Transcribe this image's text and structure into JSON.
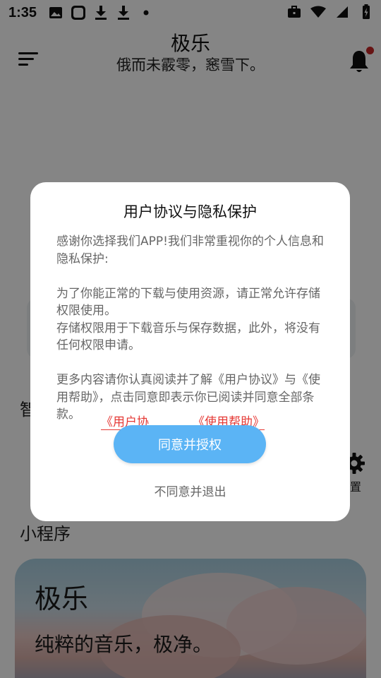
{
  "status_bar": {
    "time": "1:35",
    "left_icons": [
      "image-icon",
      "app-square-icon",
      "download-icon",
      "download-icon",
      "dot-icon"
    ],
    "right_icons": [
      "briefcase-icon",
      "wifi-icon",
      "signal-icon",
      "battery-charging-icon"
    ]
  },
  "header": {
    "title": "极乐",
    "subtitle": "俄而未霰零，窸雪下。"
  },
  "background": {
    "left_label": "智",
    "settings_label": "置",
    "section_title": "小程序",
    "banner": {
      "title": "极乐",
      "subtitle": "纯粹的音乐，极净。"
    }
  },
  "dialog": {
    "title": "用户协议与隐私保护",
    "para1": "感谢你选择我们APP!我们非常重视你的个人信息和隐私保护:",
    "para2": "为了你能正常的下载与使用资源，请正常允许存储权限使用。",
    "para3": "存储权限用于下载音乐与保存数据，此外，将没有任何权限申请。",
    "para4": "更多内容请你认真阅读并了解《用户协议》与《使用帮助》，点击同意即表示你已阅读并同意全部条款。",
    "link_user_agreement": "《用户协",
    "link_help": "《使用帮助》",
    "agree_button": "同意并授权",
    "decline_button": "不同意并退出"
  },
  "colors": {
    "accent": "#5bb4f5",
    "link": "#e53935",
    "badge": "#c62828"
  }
}
